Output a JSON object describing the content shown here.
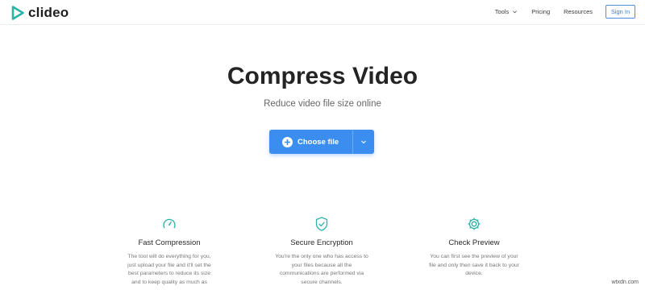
{
  "header": {
    "logo_text": "clideo",
    "nav": {
      "tools": "Tools",
      "pricing": "Pricing",
      "resources": "Resources",
      "signin": "Sign In"
    }
  },
  "hero": {
    "title": "Compress Video",
    "subtitle": "Reduce video file size online",
    "choose_label": "Choose file"
  },
  "features": [
    {
      "icon": "gauge-icon",
      "title": "Fast Compression",
      "lines": [
        "The tool will do everything for you,",
        "just upload your file and it'll set the",
        "best parameters to reduce its size",
        "and to keep quality as much as"
      ]
    },
    {
      "icon": "shield-check-icon",
      "title": "Secure Encryption",
      "lines": [
        "You're the only one who has access to",
        "your files because all the",
        "communications are performed via",
        "secure channels."
      ]
    },
    {
      "icon": "gear-icon",
      "title": "Check Preview",
      "lines": [
        "You can first see the preview of your",
        "file and only then save it back to your",
        "device."
      ]
    }
  ],
  "watermark": "wtxdn.com",
  "colors": {
    "accent": "#3b8eef",
    "teal": "#2cb3a8",
    "text": "#242424"
  }
}
